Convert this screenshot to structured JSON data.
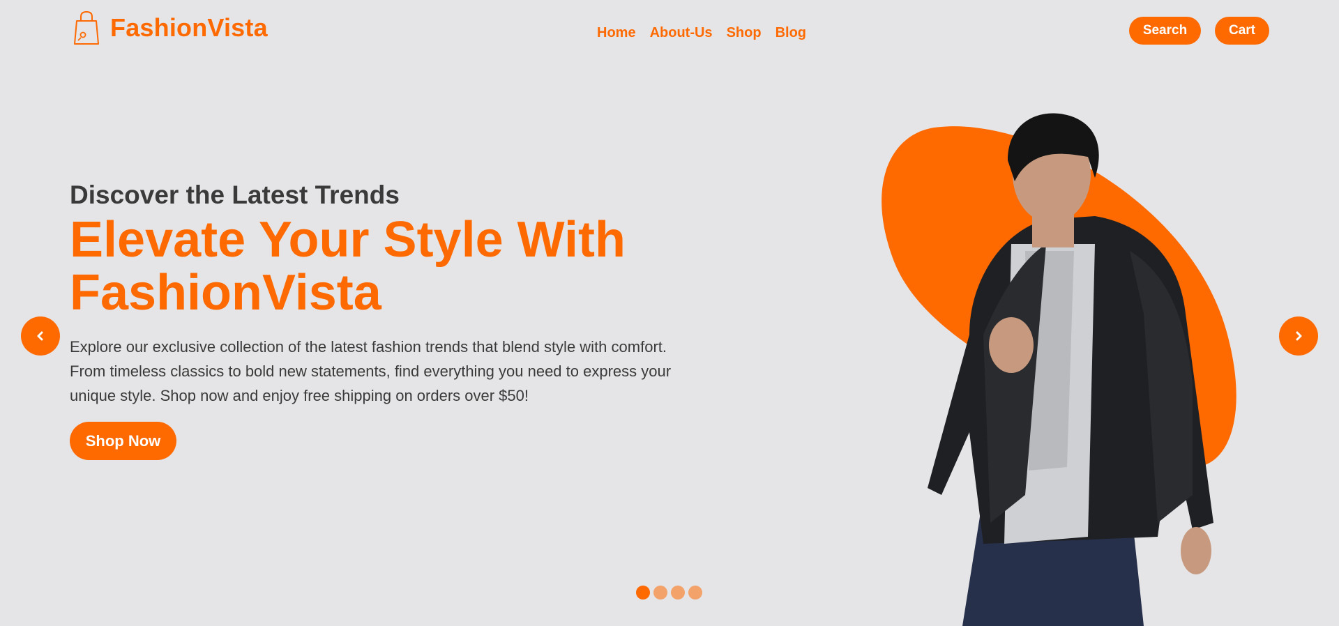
{
  "brand": {
    "name": "FashionVista",
    "logo_icon": "shopping-bag-icon",
    "accent_color": "#ff6a00"
  },
  "nav": {
    "items": [
      "Home",
      "About-Us",
      "Shop",
      "Blog"
    ]
  },
  "header_actions": {
    "search_label": "Search",
    "cart_label": "Cart"
  },
  "hero": {
    "subtitle": "Discover the Latest Trends",
    "title_line1": "Elevate Your Style With",
    "title_line2": "FashionVista",
    "description": "Explore our exclusive collection of the latest fashion trends that blend style with comfort. From timeless classics to bold new statements, find everything you need to express your unique style. Shop now and enjoy free shipping on orders over $50!",
    "cta_label": "Shop Now"
  },
  "carousel": {
    "slide_count": 4,
    "active_index": 0,
    "prev_icon": "chevron-left-icon",
    "next_icon": "chevron-right-icon"
  }
}
